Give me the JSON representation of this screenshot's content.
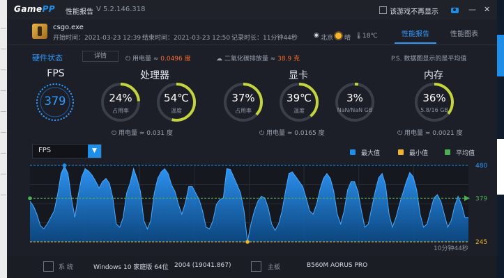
{
  "app": {
    "logo_main": "Game",
    "logo_accent": "PP",
    "title": "性能报告",
    "version": "V 5.2.146.318",
    "hide_label": "该游戏不再显示"
  },
  "game": {
    "name": "csgo.exe",
    "start_time": "开始时间：2021-03-23 12:39",
    "end_time": "结束时间：2021-03-23 12:50",
    "duration": "记录时长：11分钟44秒",
    "city": "北京",
    "weather": "晴",
    "temp": "18℃"
  },
  "tabs": [
    {
      "label": "性能报告",
      "active": true
    },
    {
      "label": "性能图表",
      "active": false
    }
  ],
  "summary": {
    "hw_label": "硬件状态",
    "detail_label": "详情",
    "power_text": "用电量 ≈ ",
    "power_value": "0.0496 度",
    "co2_text": "二氧化碳排放量 ≈ ",
    "co2_value": "38.9 克",
    "note": "P.S. 数据图显示的是平均值"
  },
  "sections": {
    "fps": {
      "title": "FPS",
      "value": "379"
    },
    "cpu": {
      "title": "处理器",
      "usage": "24%",
      "usage_label": "占用率",
      "temp": "54℃",
      "temp_label": "温度",
      "power": "用电量 ≈ 0.031 度"
    },
    "gpu": {
      "title": "显卡",
      "usage": "37%",
      "usage_label": "占用率",
      "temp": "39℃",
      "temp_label": "温度",
      "vram": "3%",
      "vram_label": "NaN/NaN GB",
      "power": "用电量 ≈ 0.0165 度"
    },
    "mem": {
      "title": "内存",
      "usage": "36%",
      "usage_label": "5.8/16 GB",
      "power": "用电量 ≈ 0.0021 度"
    }
  },
  "colors": {
    "accent": "#2f9bff",
    "max": "#1e8ee8",
    "min": "#f0b429",
    "avg": "#4caf50"
  },
  "chart_data": {
    "type": "area",
    "selector": "FPS",
    "legend": [
      {
        "label": "最大值",
        "color": "#1e8ee8"
      },
      {
        "label": "最小值",
        "color": "#f0b429"
      },
      {
        "label": "平均值",
        "color": "#4caf50"
      }
    ],
    "max_label": "480",
    "avg_label": "379",
    "min_label": "245",
    "ylim": [
      245,
      480
    ],
    "max": 480,
    "avg": 379,
    "min": 245,
    "xlabel": "10分钟44秒",
    "series": [
      {
        "values": [
          370,
          355,
          330,
          295,
          285,
          300,
          320,
          340,
          390,
          455,
          478,
          455,
          380,
          320,
          390,
          445,
          470,
          462,
          450,
          432,
          410,
          430,
          440,
          425,
          380,
          300,
          290,
          320,
          395,
          425,
          470,
          440,
          400,
          310,
          285,
          310,
          395,
          440,
          460,
          470,
          455,
          420,
          400,
          360,
          330,
          365,
          415,
          415,
          395,
          375,
          340,
          290,
          285,
          310,
          360,
          375,
          380,
          470,
          468,
          445,
          420,
          395,
          340,
          245,
          300,
          340,
          370,
          385,
          380,
          350,
          300,
          280,
          300,
          340,
          400,
          455,
          460,
          445,
          430,
          415,
          380,
          340,
          330,
          360,
          405,
          440,
          455,
          440,
          400,
          330,
          300,
          340,
          405,
          430,
          430,
          400,
          340,
          290,
          300,
          350,
          400,
          442,
          455,
          420,
          330,
          290,
          320,
          360,
          395,
          430,
          458,
          445,
          405,
          330,
          290,
          300,
          340,
          380,
          390,
          370,
          330,
          290,
          310,
          355,
          385,
          360,
          320,
          320
        ]
      }
    ]
  },
  "bottom": {
    "os_label": "系 统",
    "os_value": "Windows 10 家庭版 64位",
    "os_build": "2004 (19041.867)",
    "mb_label": "主板",
    "mb_value": "B560M AORUS PRO"
  }
}
